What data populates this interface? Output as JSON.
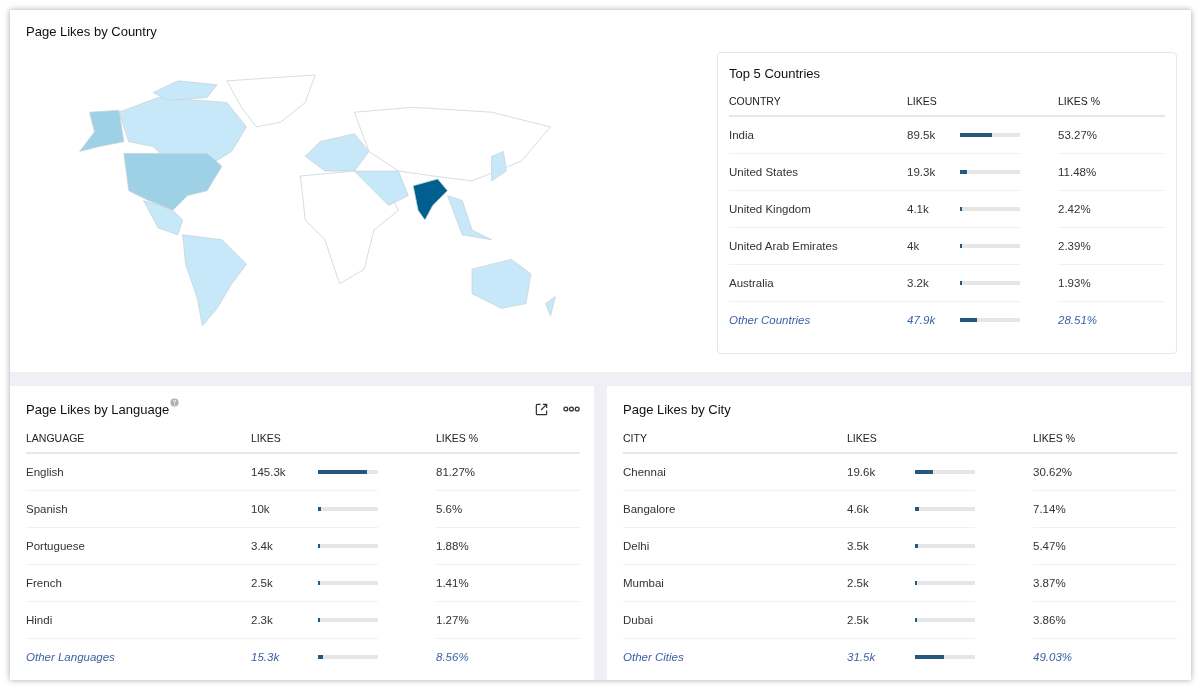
{
  "country_panel": {
    "title": "Page Likes by Country",
    "top": {
      "title": "Top 5 Countries",
      "columns": [
        "COUNTRY",
        "LIKES",
        "LIKES %"
      ],
      "rows": [
        {
          "kind": "item",
          "name": "India",
          "likes": "89.5k",
          "level": 0.5327,
          "percent": "53.27%"
        },
        {
          "kind": "item",
          "name": "United States",
          "likes": "19.3k",
          "level": 0.1148,
          "percent": "11.48%"
        },
        {
          "kind": "item",
          "name": "United Kingdom",
          "likes": "4.1k",
          "level": 0.0242,
          "percent": "2.42%"
        },
        {
          "kind": "item",
          "name": "United Arab Emirates",
          "likes": "4k",
          "level": 0.0239,
          "percent": "2.39%"
        },
        {
          "kind": "item",
          "name": "Australia",
          "likes": "3.2k",
          "level": 0.0193,
          "percent": "1.93%"
        },
        {
          "kind": "other",
          "name": "Other Countries",
          "likes": "47.9k",
          "level": 0.2851,
          "percent": "28.51%"
        }
      ]
    }
  },
  "language_panel": {
    "title": "Page Likes by Language",
    "columns": [
      "LANGUAGE",
      "LIKES",
      "LIKES %"
    ],
    "rows": [
      {
        "kind": "item",
        "name": "English",
        "likes": "145.3k",
        "level": 0.8127,
        "percent": "81.27%"
      },
      {
        "kind": "item",
        "name": "Spanish",
        "likes": "10k",
        "level": 0.056,
        "percent": "5.6%"
      },
      {
        "kind": "item",
        "name": "Portuguese",
        "likes": "3.4k",
        "level": 0.0188,
        "percent": "1.88%"
      },
      {
        "kind": "item",
        "name": "French",
        "likes": "2.5k",
        "level": 0.0141,
        "percent": "1.41%"
      },
      {
        "kind": "item",
        "name": "Hindi",
        "likes": "2.3k",
        "level": 0.0127,
        "percent": "1.27%"
      },
      {
        "kind": "other",
        "name": "Other Languages",
        "likes": "15.3k",
        "level": 0.0856,
        "percent": "8.56%"
      }
    ]
  },
  "city_panel": {
    "title": "Page Likes by City",
    "columns": [
      "CITY",
      "LIKES",
      "LIKES %"
    ],
    "rows": [
      {
        "kind": "item",
        "name": "Chennai",
        "likes": "19.6k",
        "level": 0.3062,
        "percent": "30.62%"
      },
      {
        "kind": "item",
        "name": "Bangalore",
        "likes": "4.6k",
        "level": 0.0714,
        "percent": "7.14%"
      },
      {
        "kind": "item",
        "name": "Delhi",
        "likes": "3.5k",
        "level": 0.0547,
        "percent": "5.47%"
      },
      {
        "kind": "item",
        "name": "Mumbai",
        "likes": "2.5k",
        "level": 0.0387,
        "percent": "3.87%"
      },
      {
        "kind": "item",
        "name": "Dubai",
        "likes": "2.5k",
        "level": 0.0386,
        "percent": "3.86%"
      },
      {
        "kind": "other",
        "name": "Other Cities",
        "likes": "31.5k",
        "level": 0.4903,
        "percent": "49.03%"
      }
    ]
  }
}
